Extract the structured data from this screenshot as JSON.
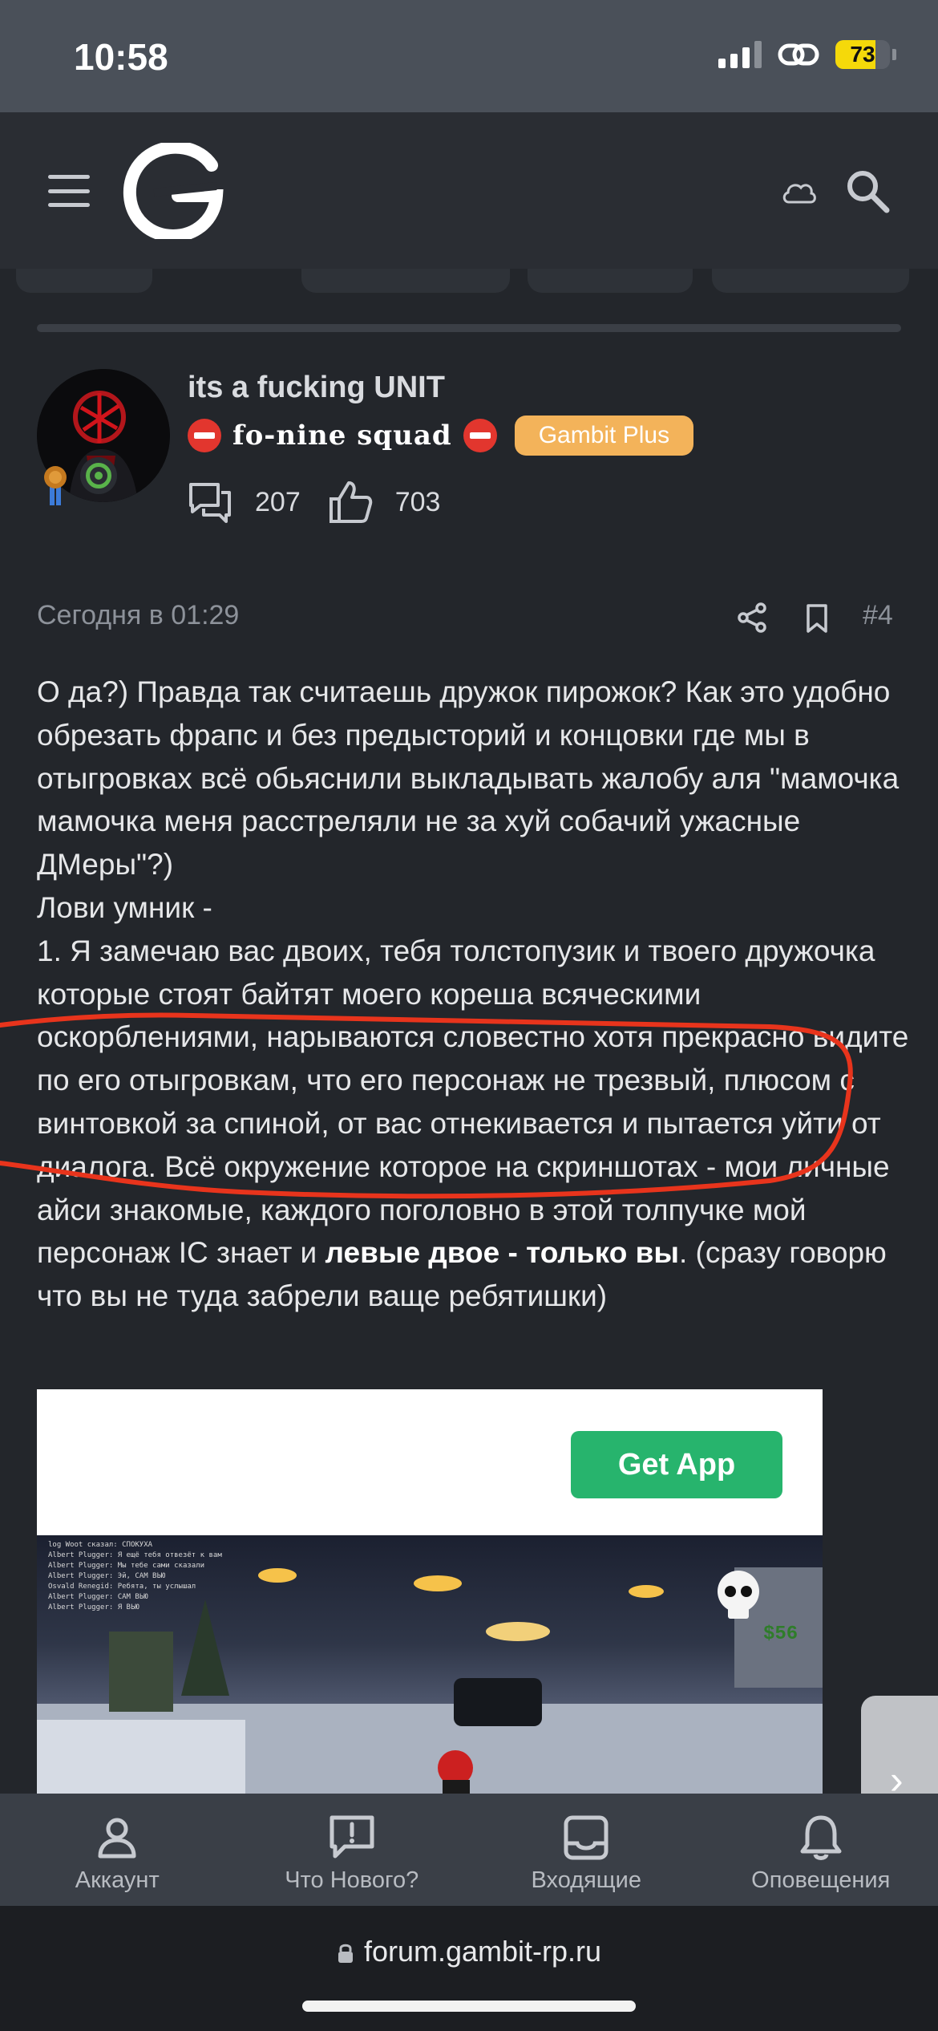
{
  "status_bar": {
    "time": "10:58",
    "battery": "73",
    "battery_level": 0.73
  },
  "header": {
    "logo_letter": "G"
  },
  "author": {
    "name": "its a fucking UNIT",
    "title": "fo-nine squad",
    "plus_badge": "Gambit Plus",
    "messages": "207",
    "reactions": "703"
  },
  "post": {
    "date": "Сегодня в 01:29",
    "number": "#4",
    "p1": "О да?) Правда так считаешь дружок пирожок? Как это удобно обрезать фрапс и без предысторий и концовки где мы в отыгровках всё обьяснили выкладывать жалобу аля \"мамочка мамочка меня расстреляли не за хуй собачий ужасные ДМеры\"?)",
    "p2": "Лови умник -",
    "p3": "1. Я замечаю вас двоих, тебя толстопузик и твоего дружочка которые стоят байтят моего кореша всяческими оскорблениями, нарываются словестно хотя прекрасно видите по его отыгровкам, что его персонаж не трезвый, плюсом с винтовкой за спиной, от вас отнекивается и пытается уйти от диалога. Всё окружение которое на скриншотах - мои личные айси знакомые, каждого поголовно в этой толпучке мой персонаж IC знает и ",
    "p3_bold": "левые двое - только вы",
    "p3_end": ". (сразу говорю что вы не туда забрели ваще ребятишки)"
  },
  "embed": {
    "button": "Get App",
    "hud_money": "$56",
    "chat": [
      "log Woot сказал: СПОКУХА",
      "Albert Plugger: Я ещё тебя отвезёт к вам",
      "Albert Plugger: Мы тебе сами сказали",
      "Albert Plugger: Эй, САМ ВЬЮ",
      "Osvald Renegid: Ребята, ты услышал",
      "Albert Plugger: САМ ВЬЮ",
      "Albert Plugger: Я ВЬЮ"
    ]
  },
  "bottom_nav": [
    {
      "label": "Аккаунт"
    },
    {
      "label": "Что Нового?"
    },
    {
      "label": "Входящие"
    },
    {
      "label": "Оповещения"
    }
  ],
  "browser": {
    "url": "forum.gambit-rp.ru"
  },
  "colors": {
    "accent_green": "#27b46d",
    "badge_orange": "#f3b35a",
    "annotation_red": "#e8341c",
    "battery_yellow": "#f5d90a"
  }
}
